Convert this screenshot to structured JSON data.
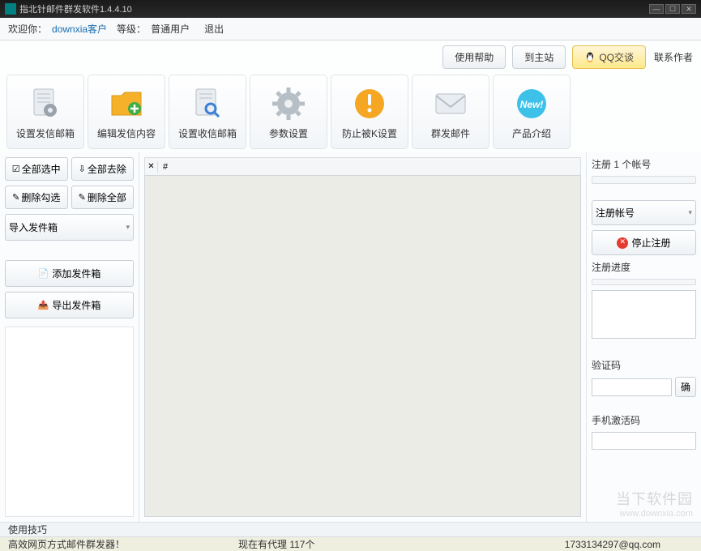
{
  "window": {
    "title": "指北针邮件群发软件1.4.4.10"
  },
  "menubar": {
    "welcome_prefix": "欢迎你：",
    "username": "downxia客户",
    "grade_prefix": "等级：",
    "grade": "普通用户",
    "logout": "退出"
  },
  "topbuttons": {
    "help": "使用帮助",
    "main_site": "到主站",
    "qq_chat": "QQ交谈",
    "contact": "联系作者"
  },
  "toolbar": [
    {
      "id": "set-sender-mailbox",
      "label": "设置发信邮箱",
      "icon": "file-gear-icon",
      "color": "#b6bec6"
    },
    {
      "id": "edit-send-content",
      "label": "编辑发信内容",
      "icon": "folder-plus-icon",
      "color": "#f5b12a"
    },
    {
      "id": "set-receiver-mailbox",
      "label": "设置收信邮箱",
      "icon": "file-search-icon",
      "color": "#b6bec6"
    },
    {
      "id": "param-settings",
      "label": "参数设置",
      "icon": "gear-icon",
      "color": "#9ba5ae"
    },
    {
      "id": "anti-k-settings",
      "label": "防止被K设置",
      "icon": "warning-icon",
      "color": "#f5a623"
    },
    {
      "id": "bulk-send",
      "label": "群发邮件",
      "icon": "envelope-icon",
      "color": "#c7cdd3"
    },
    {
      "id": "product-intro",
      "label": "产品介绍",
      "icon": "new-badge-icon",
      "color": "#3ec1e8"
    }
  ],
  "left": {
    "select_all": "全部选中",
    "remove_all": "全部去除",
    "delete_checked": "删除勾选",
    "delete_all": "删除全部",
    "import_sender": "导入发件箱",
    "add_sender": "添加发件箱",
    "export_sender": "导出发件箱"
  },
  "center": {
    "tab_label": "#"
  },
  "right": {
    "register_count_label": "注册 1 个帐号",
    "register_account": "注册帐号",
    "stop_register": "停止注册",
    "register_progress": "注册进度",
    "captcha_label": "验证码",
    "confirm_short": "确",
    "phone_code_label": "手机激活码"
  },
  "tipbar": {
    "tips": "使用技巧"
  },
  "statusbar": {
    "slogan": "高效网页方式邮件群发器！",
    "proxy_status": "现在有代理 117个",
    "email": "1733134297@qq.com"
  },
  "watermark": {
    "main": "当下软件园",
    "sub": "www.downxia.com"
  }
}
